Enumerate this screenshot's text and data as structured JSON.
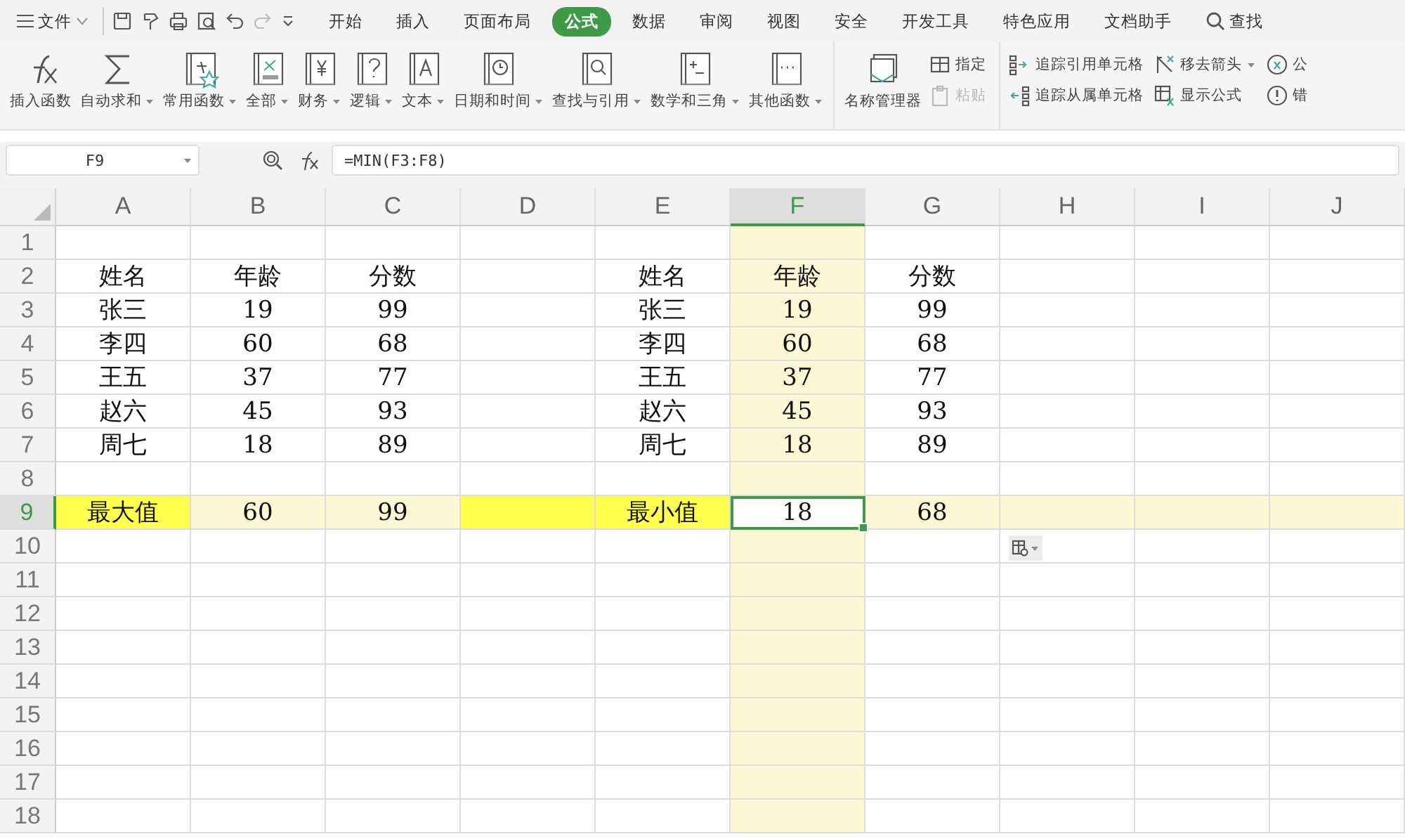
{
  "menu_bar": {
    "file_menu": "文件",
    "tabs": [
      {
        "label": "开始",
        "selected": false
      },
      {
        "label": "插入",
        "selected": false
      },
      {
        "label": "页面布局",
        "selected": false
      },
      {
        "label": "公式",
        "selected": true
      },
      {
        "label": "数据",
        "selected": false
      },
      {
        "label": "审阅",
        "selected": false
      },
      {
        "label": "视图",
        "selected": false
      },
      {
        "label": "安全",
        "selected": false
      },
      {
        "label": "开发工具",
        "selected": false
      },
      {
        "label": "特色应用",
        "selected": false
      },
      {
        "label": "文档助手",
        "selected": false
      }
    ],
    "search": "查找"
  },
  "ribbon": {
    "groups": [
      {
        "items": [
          {
            "label": "插入函数",
            "kind": "large",
            "dropdown": false
          },
          {
            "label": "自动求和",
            "kind": "large",
            "dropdown": true
          },
          {
            "label": "常用函数",
            "kind": "large",
            "dropdown": true
          },
          {
            "label": "全部",
            "kind": "large",
            "dropdown": true
          },
          {
            "label": "财务",
            "kind": "large",
            "dropdown": true
          },
          {
            "label": "逻辑",
            "kind": "large",
            "dropdown": true
          },
          {
            "label": "文本",
            "kind": "large",
            "dropdown": true
          },
          {
            "label": "日期和时间",
            "kind": "large",
            "dropdown": true
          },
          {
            "label": "查找与引用",
            "kind": "large",
            "dropdown": true
          },
          {
            "label": "数学和三角",
            "kind": "large",
            "dropdown": true
          },
          {
            "label": "其他函数",
            "kind": "large",
            "dropdown": true
          }
        ]
      },
      {
        "items": [
          {
            "label": "名称管理器",
            "kind": "large",
            "dropdown": false
          },
          {
            "label": "指定",
            "kind": "small",
            "dropdown": false,
            "disabled": false
          },
          {
            "label": "粘贴",
            "kind": "small",
            "dropdown": false,
            "disabled": true
          }
        ]
      },
      {
        "items": [
          {
            "label": "追踪引用单元格",
            "kind": "small",
            "dropdown": false
          },
          {
            "label": "追踪从属单元格",
            "kind": "small",
            "dropdown": false
          },
          {
            "label": "移去箭头",
            "kind": "small",
            "dropdown": true
          },
          {
            "label": "显示公式",
            "kind": "small",
            "dropdown": false
          },
          {
            "label": "公",
            "kind": "small",
            "dropdown": false
          },
          {
            "label": "错",
            "kind": "small",
            "dropdown": false
          }
        ]
      }
    ]
  },
  "formula_bar": {
    "name_box": "F9",
    "formula": "=MIN(F3:F8)"
  },
  "sheet": {
    "columns": [
      {
        "label": "A",
        "selected": false
      },
      {
        "label": "B",
        "selected": false
      },
      {
        "label": "C",
        "selected": false
      },
      {
        "label": "D",
        "selected": false
      },
      {
        "label": "E",
        "selected": false
      },
      {
        "label": "F",
        "selected": true
      },
      {
        "label": "G",
        "selected": false
      },
      {
        "label": "H",
        "selected": false
      },
      {
        "label": "I",
        "selected": false
      },
      {
        "label": "J",
        "selected": false
      }
    ],
    "rows": [
      {
        "label": "1",
        "selected": false,
        "cells": {}
      },
      {
        "label": "2",
        "selected": false,
        "cells": {
          "A": {
            "text": "姓名"
          },
          "B": {
            "text": "年龄"
          },
          "C": {
            "text": "分数"
          },
          "E": {
            "text": "姓名"
          },
          "F": {
            "text": "年龄"
          },
          "G": {
            "text": "分数"
          }
        }
      },
      {
        "label": "3",
        "selected": false,
        "cells": {
          "A": {
            "text": "张三"
          },
          "B": {
            "text": "19"
          },
          "C": {
            "text": "99"
          },
          "E": {
            "text": "张三"
          },
          "F": {
            "text": "19"
          },
          "G": {
            "text": "99"
          }
        }
      },
      {
        "label": "4",
        "selected": false,
        "cells": {
          "A": {
            "text": "李四"
          },
          "B": {
            "text": "60"
          },
          "C": {
            "text": "68"
          },
          "E": {
            "text": "李四"
          },
          "F": {
            "text": "60"
          },
          "G": {
            "text": "68"
          }
        }
      },
      {
        "label": "5",
        "selected": false,
        "cells": {
          "A": {
            "text": "王五"
          },
          "B": {
            "text": "37"
          },
          "C": {
            "text": "77"
          },
          "E": {
            "text": "王五"
          },
          "F": {
            "text": "37"
          },
          "G": {
            "text": "77"
          }
        }
      },
      {
        "label": "6",
        "selected": false,
        "cells": {
          "A": {
            "text": "赵六"
          },
          "B": {
            "text": "45"
          },
          "C": {
            "text": "93"
          },
          "E": {
            "text": "赵六"
          },
          "F": {
            "text": "45"
          },
          "G": {
            "text": "93"
          }
        }
      },
      {
        "label": "7",
        "selected": false,
        "cells": {
          "A": {
            "text": "周七"
          },
          "B": {
            "text": "18"
          },
          "C": {
            "text": "89"
          },
          "E": {
            "text": "周七"
          },
          "F": {
            "text": "18"
          },
          "G": {
            "text": "89"
          }
        }
      },
      {
        "label": "8",
        "selected": false,
        "cells": {}
      },
      {
        "label": "9",
        "selected": true,
        "cells": {
          "A": {
            "text": "最大值",
            "filled": true
          },
          "B": {
            "text": "60",
            "filled": false
          },
          "C": {
            "text": "99",
            "filled": false
          },
          "D": {
            "filled": true
          },
          "E": {
            "text": "最小值",
            "filled": true
          },
          "F": {
            "text": "18",
            "filled": false
          },
          "G": {
            "text": "68",
            "filled": false
          }
        }
      },
      {
        "label": "10",
        "selected": false,
        "cells": {}
      },
      {
        "label": "11",
        "selected": false,
        "cells": {}
      },
      {
        "label": "12",
        "selected": false,
        "cells": {}
      },
      {
        "label": "13",
        "selected": false,
        "cells": {}
      },
      {
        "label": "14",
        "selected": false,
        "cells": {}
      },
      {
        "label": "15",
        "selected": false,
        "cells": {}
      },
      {
        "label": "16",
        "selected": false,
        "cells": {}
      },
      {
        "label": "17",
        "selected": false,
        "cells": {}
      },
      {
        "label": "18",
        "selected": false,
        "cells": {}
      }
    ]
  }
}
